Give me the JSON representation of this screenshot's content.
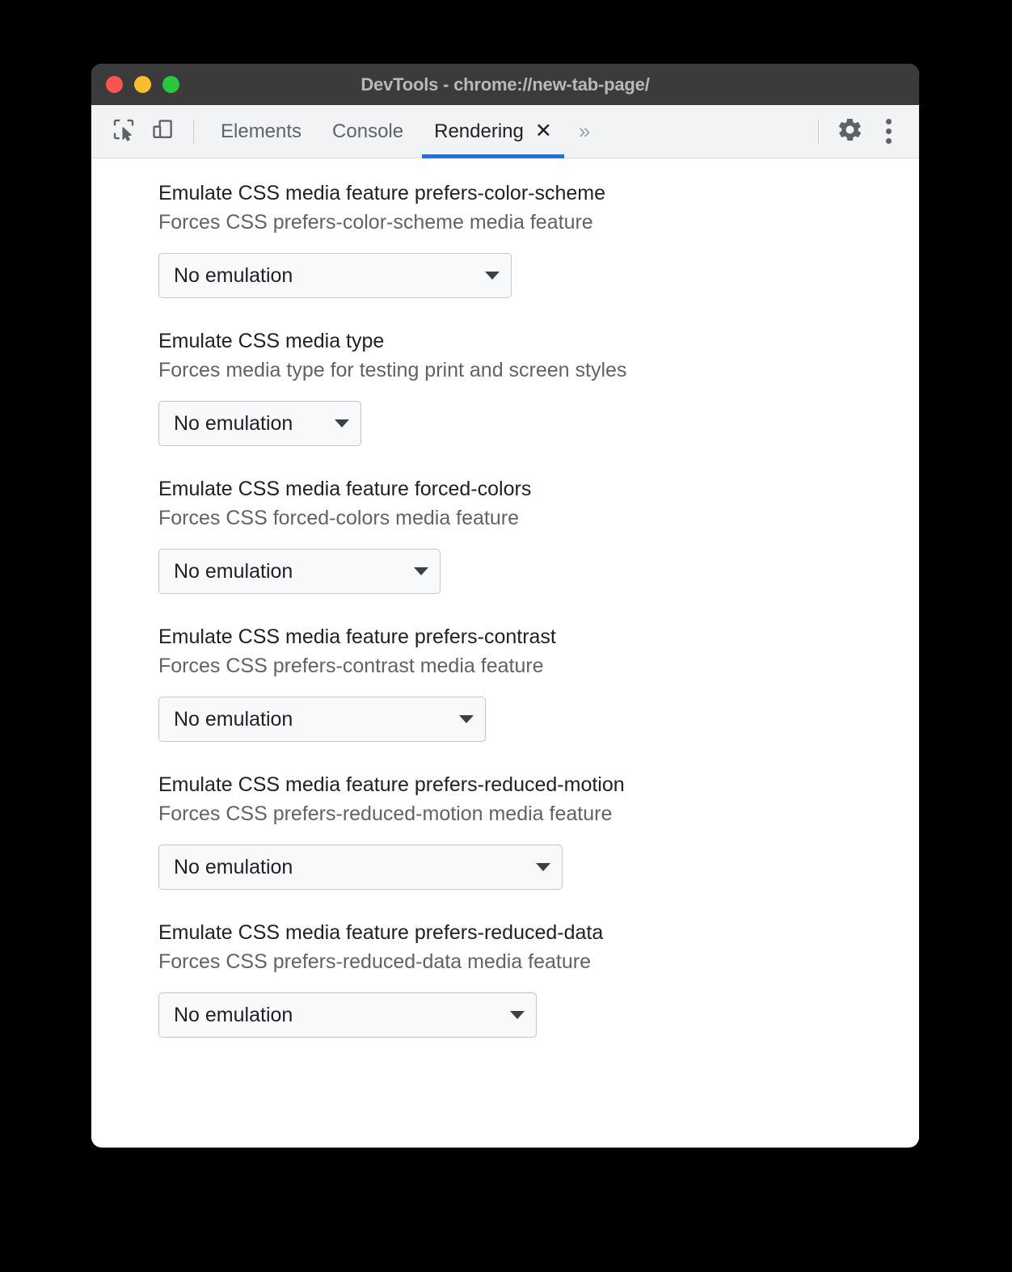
{
  "window": {
    "title": "DevTools - chrome://new-tab-page/",
    "traffic_lights": [
      {
        "name": "close",
        "color": "#f9554e"
      },
      {
        "name": "minimize",
        "color": "#fbbd2e"
      },
      {
        "name": "zoom",
        "color": "#28c83f"
      }
    ]
  },
  "toolbar": {
    "inspect_icon": "inspect-element-icon",
    "device_toolbar_icon": "device-toolbar-icon",
    "tabs": [
      {
        "label": "Elements",
        "active": false,
        "closable": false
      },
      {
        "label": "Console",
        "active": false,
        "closable": false
      },
      {
        "label": "Rendering",
        "active": true,
        "closable": true,
        "close_glyph": "✕"
      }
    ],
    "more_tabs_glyph": "»",
    "settings_icon": "gear-icon",
    "more_options_icon": "three-dot-menu-icon",
    "active_tab_accent": "#1a73e8"
  },
  "panel": {
    "settings": [
      {
        "title": "Emulate CSS media feature prefers-color-scheme",
        "description": "Forces CSS prefers-color-scheme media feature",
        "select_value": "No emulation",
        "select_width": 437
      },
      {
        "title": "Emulate CSS media type",
        "description": "Forces media type for testing print and screen styles",
        "select_value": "No emulation",
        "select_width": 251
      },
      {
        "title": "Emulate CSS media feature forced-colors",
        "description": "Forces CSS forced-colors media feature",
        "select_value": "No emulation",
        "select_width": 349
      },
      {
        "title": "Emulate CSS media feature prefers-contrast",
        "description": "Forces CSS prefers-contrast media feature",
        "select_value": "No emulation",
        "select_width": 405
      },
      {
        "title": "Emulate CSS media feature prefers-reduced-motion",
        "description": "Forces CSS prefers-reduced-motion media feature",
        "select_value": "No emulation",
        "select_width": 500
      },
      {
        "title": "Emulate CSS media feature prefers-reduced-data",
        "description": "Forces CSS prefers-reduced-data media feature",
        "select_value": "No emulation",
        "select_width": 468
      }
    ]
  }
}
